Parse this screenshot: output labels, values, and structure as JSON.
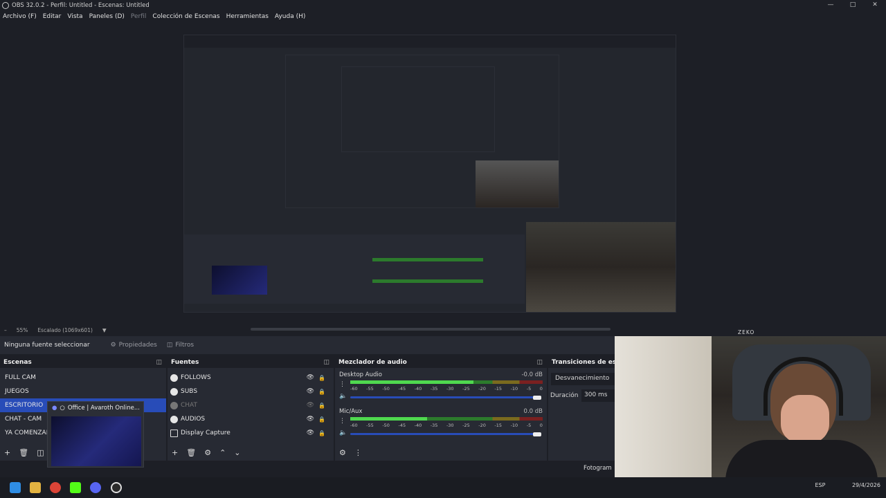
{
  "window": {
    "title": "OBS 32.0.2 - Perfil: Untitled - Escenas: Untitled"
  },
  "menu": {
    "items": [
      "Archivo (F)",
      "Editar",
      "Vista",
      "Paneles (D)",
      "Perfil",
      "Colección de Escenas",
      "Herramientas",
      "Ayuda (H)"
    ]
  },
  "preview": {
    "zoom": "55%",
    "scale": "Escalado (1069x601)"
  },
  "source_bar": {
    "no_selection": "Ninguna fuente seleccionar",
    "properties": "Propiedades",
    "filters": "Filtros"
  },
  "scenes": {
    "title": "Escenas",
    "items": [
      "FULL CAM",
      "JUEGOS",
      "ESCRITORIO",
      "CHAT - CAM",
      "YA COMENZAM"
    ]
  },
  "sources": {
    "title": "Fuentes",
    "items": [
      "FOLLOWS",
      "SUBS",
      "CHAT",
      "AUDIOS",
      "Display Capture"
    ]
  },
  "mixer": {
    "title": "Mezclador de audio",
    "channels": [
      {
        "name": "Desktop Audio",
        "db": "-0.0 dB",
        "level": 0.64
      },
      {
        "name": "Mic/Aux",
        "db": "0.0 dB",
        "level": 0.4
      }
    ],
    "ticks": [
      "-60",
      "-55",
      "-50",
      "-45",
      "-40",
      "-35",
      "-30",
      "-25",
      "-20",
      "-15",
      "-10",
      "-5",
      "0"
    ]
  },
  "transitions": {
    "title": "Transiciones de esce",
    "type": "Desvanecimiento",
    "duration_label": "Duración",
    "duration_value": "300 ms"
  },
  "popup": {
    "label": "Office | Avaroth Online..."
  },
  "footer": {
    "fotograma": "Fotogram"
  },
  "webcam": {
    "overlay_text": "ZEKO"
  },
  "tray": {
    "lang": "ESP",
    "date": "29/4/2026"
  },
  "colors": {
    "selection": "#284cb8",
    "dock_bg": "#272a33",
    "window_bg": "#1d1f26"
  },
  "icons": [
    "obs-icon",
    "minimize-icon",
    "maximize-icon",
    "close-icon",
    "gear-icon",
    "filter-icon",
    "eye-icon",
    "lock-icon",
    "plus-icon",
    "trash-icon",
    "up-icon",
    "down-icon",
    "speaker-icon",
    "windows-icon",
    "folder-icon",
    "chrome-icon",
    "kick-icon",
    "discord-icon",
    "obs-taskbar-icon"
  ]
}
